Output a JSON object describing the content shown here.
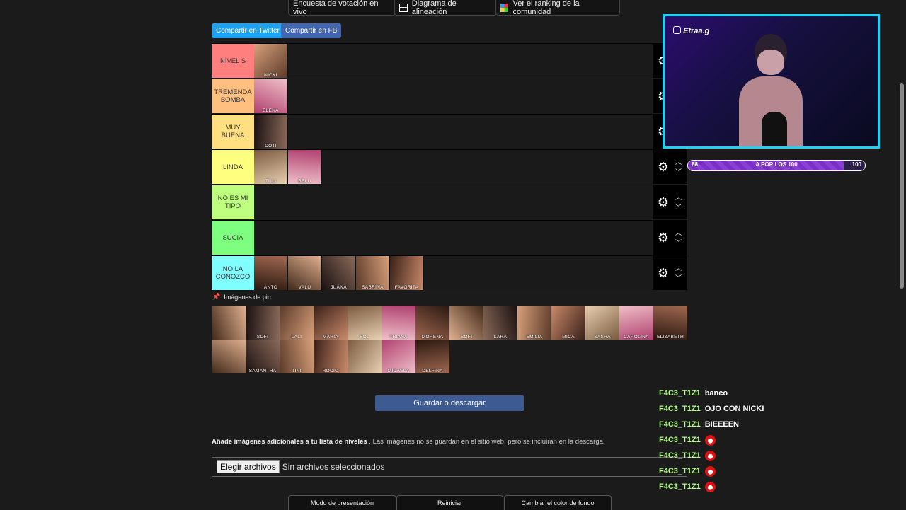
{
  "top_buttons": [
    {
      "label": "Encuesta de votación en vivo",
      "icon": ""
    },
    {
      "label": "Diagrama de alineación",
      "icon": "grid-icon"
    },
    {
      "label": "Ver el ranking de la comunidad",
      "icon": "mosaic-icon"
    }
  ],
  "share": {
    "twitter": "Compartir en Twitter",
    "facebook": "Compartir en FB"
  },
  "tiers": [
    {
      "label": "NIVEL S",
      "color": "#ff7f7f",
      "items": [
        "NICKI"
      ]
    },
    {
      "label": "TREMENDA BOMBA",
      "color": "#ffbf7f",
      "items": [
        "ELENA"
      ]
    },
    {
      "label": "MUY BUENA",
      "color": "#ffdf7f",
      "items": [
        "COTI"
      ]
    },
    {
      "label": "LINDA",
      "color": "#ffff7f",
      "items": [
        "TULI",
        "BELU"
      ]
    },
    {
      "label": "NO ES MI TIPO",
      "color": "#bfff7f",
      "items": []
    },
    {
      "label": "SUCIA",
      "color": "#7fff7f",
      "items": []
    },
    {
      "label": "NO LA CONOZCO",
      "color": "#7fffff",
      "items": [
        "ANTO",
        "VALU",
        "JUANA",
        "SABRINA",
        "FAVORITA"
      ]
    }
  ],
  "pin": {
    "header": "Imágenes de pin"
  },
  "pool": [
    "",
    "SOFI",
    "LALI",
    "MARIA",
    "SOL",
    "TRIANA",
    "MORENA",
    "SOFI",
    "LARA",
    "EMILIA",
    "MICA",
    "SASHA",
    "CAROLINA",
    "ELIZABETH",
    "",
    "SAMANTHA",
    "TINI",
    "ROCIO",
    "",
    "MICAELA",
    "DELFINA"
  ],
  "save_label": "Guardar o descargar",
  "add_images": {
    "title": "Añade imágenes adicionales a tu lista de niveles",
    "note": ". Las imágenes no se guardan en el sitio web, pero se incluirán en la descarga."
  },
  "file": {
    "button": "Elegir archivos",
    "status": "Sin archivos seleccionados"
  },
  "bottom_buttons": [
    "Modo de presentación",
    "Reiniciar",
    "Cambiar el color de fondo"
  ],
  "stream": {
    "tag": "Efraa.g",
    "progress": {
      "current": "88",
      "label": "A POR LOS 100",
      "max": "100",
      "fraction": 0.88
    }
  },
  "chat": [
    {
      "user": "F4C3_T1Z1",
      "msg": "banco"
    },
    {
      "user": "F4C3_T1Z1",
      "msg": "OJO CON NICKI"
    },
    {
      "user": "F4C3_T1Z1",
      "msg": "BIEEEEN"
    },
    {
      "user": "F4C3_T1Z1",
      "msg": "",
      "emote": true
    },
    {
      "user": "F4C3_T1Z1",
      "msg": "",
      "emote": true
    },
    {
      "user": "F4C3_T1Z1",
      "msg": "",
      "emote": true
    },
    {
      "user": "F4C3_T1Z1",
      "msg": "",
      "emote": true
    }
  ]
}
